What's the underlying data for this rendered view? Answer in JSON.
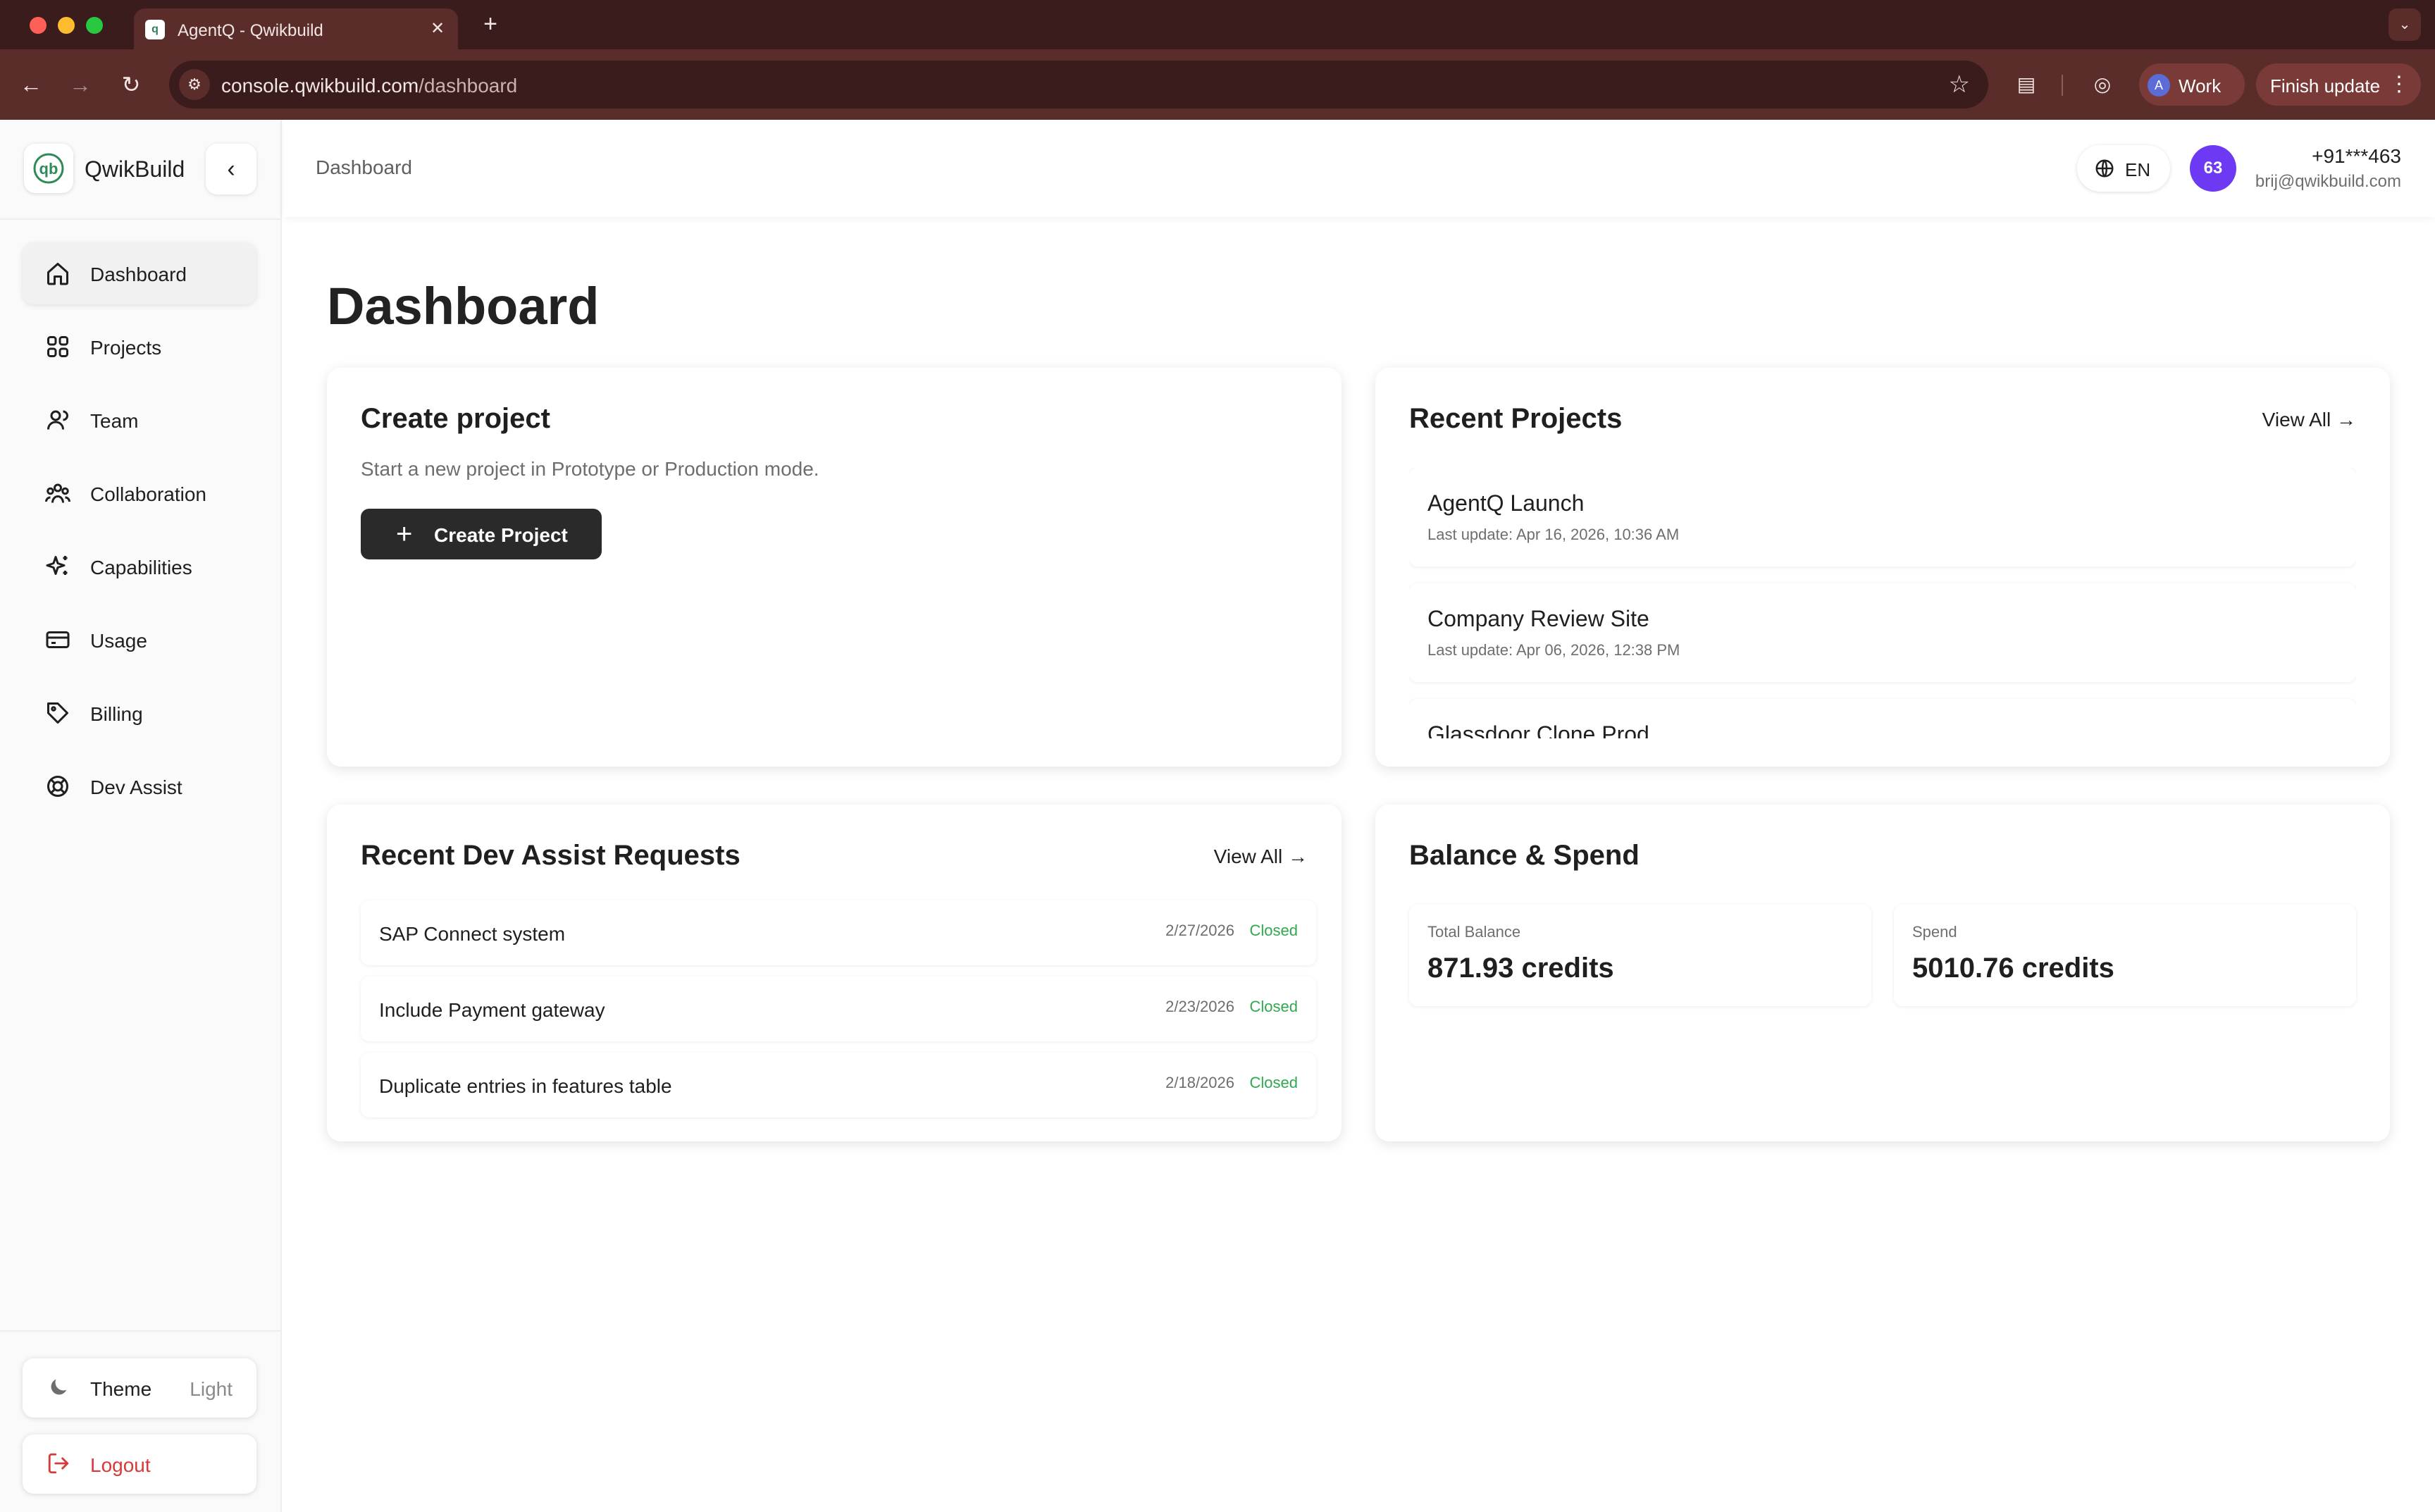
{
  "browser": {
    "tab_title": "AgentQ - Qwikbuild",
    "url_host": "console.qwikbuild.com",
    "url_path": "/dashboard",
    "profile_initial": "A",
    "profile_label": "Work",
    "update_label": "Finish update"
  },
  "sidebar": {
    "brand": "QwikBuild",
    "items": [
      {
        "label": "Dashboard",
        "icon": "home-icon",
        "active": true
      },
      {
        "label": "Projects",
        "icon": "grid-icon",
        "active": false
      },
      {
        "label": "Team",
        "icon": "users-icon",
        "active": false
      },
      {
        "label": "Collaboration",
        "icon": "collaboration-icon",
        "active": false
      },
      {
        "label": "Capabilities",
        "icon": "sparkles-icon",
        "active": false
      },
      {
        "label": "Usage",
        "icon": "credit-card-icon",
        "active": false
      },
      {
        "label": "Billing",
        "icon": "tag-icon",
        "active": false
      },
      {
        "label": "Dev Assist",
        "icon": "lifebuoy-icon",
        "active": false
      }
    ],
    "theme_label": "Theme",
    "theme_value": "Light",
    "logout_label": "Logout"
  },
  "header": {
    "breadcrumb": "Dashboard",
    "language": "EN",
    "avatar_text": "63",
    "phone": "+91***463",
    "email": "brij@qwikbuild.com"
  },
  "page": {
    "title": "Dashboard"
  },
  "create_project": {
    "title": "Create project",
    "description": "Start a new project in Prototype or Production mode.",
    "button_label": "Create Project"
  },
  "recent_projects": {
    "title": "Recent Projects",
    "view_all": "View All →",
    "items": [
      {
        "name": "AgentQ Launch",
        "updated": "Last update: Apr 16, 2026, 10:36 AM"
      },
      {
        "name": "Company Review Site",
        "updated": "Last update: Apr 06, 2026, 12:38 PM"
      },
      {
        "name": "Glassdoor Clone Prod",
        "updated": ""
      }
    ]
  },
  "dev_assist": {
    "title": "Recent Dev Assist Requests",
    "view_all": "View All →",
    "requests": [
      {
        "title": "SAP Connect system",
        "date": "2/27/2026",
        "status": "Closed"
      },
      {
        "title": "Include Payment gateway",
        "date": "2/23/2026",
        "status": "Closed"
      },
      {
        "title": "Duplicate entries in features table",
        "date": "2/18/2026",
        "status": "Closed"
      }
    ]
  },
  "balance": {
    "title": "Balance & Spend",
    "total_label": "Total Balance",
    "total_value": "871.93 credits",
    "spend_label": "Spend",
    "spend_value": "5010.76 credits"
  },
  "colors": {
    "chrome_dark": "#3b1c1c",
    "chrome_toolbar": "#5a2d2b",
    "avatar": "#6d39f2",
    "status_closed": "#2fa84f",
    "logout": "#d83a3a",
    "primary_button": "#2a2a2a"
  }
}
